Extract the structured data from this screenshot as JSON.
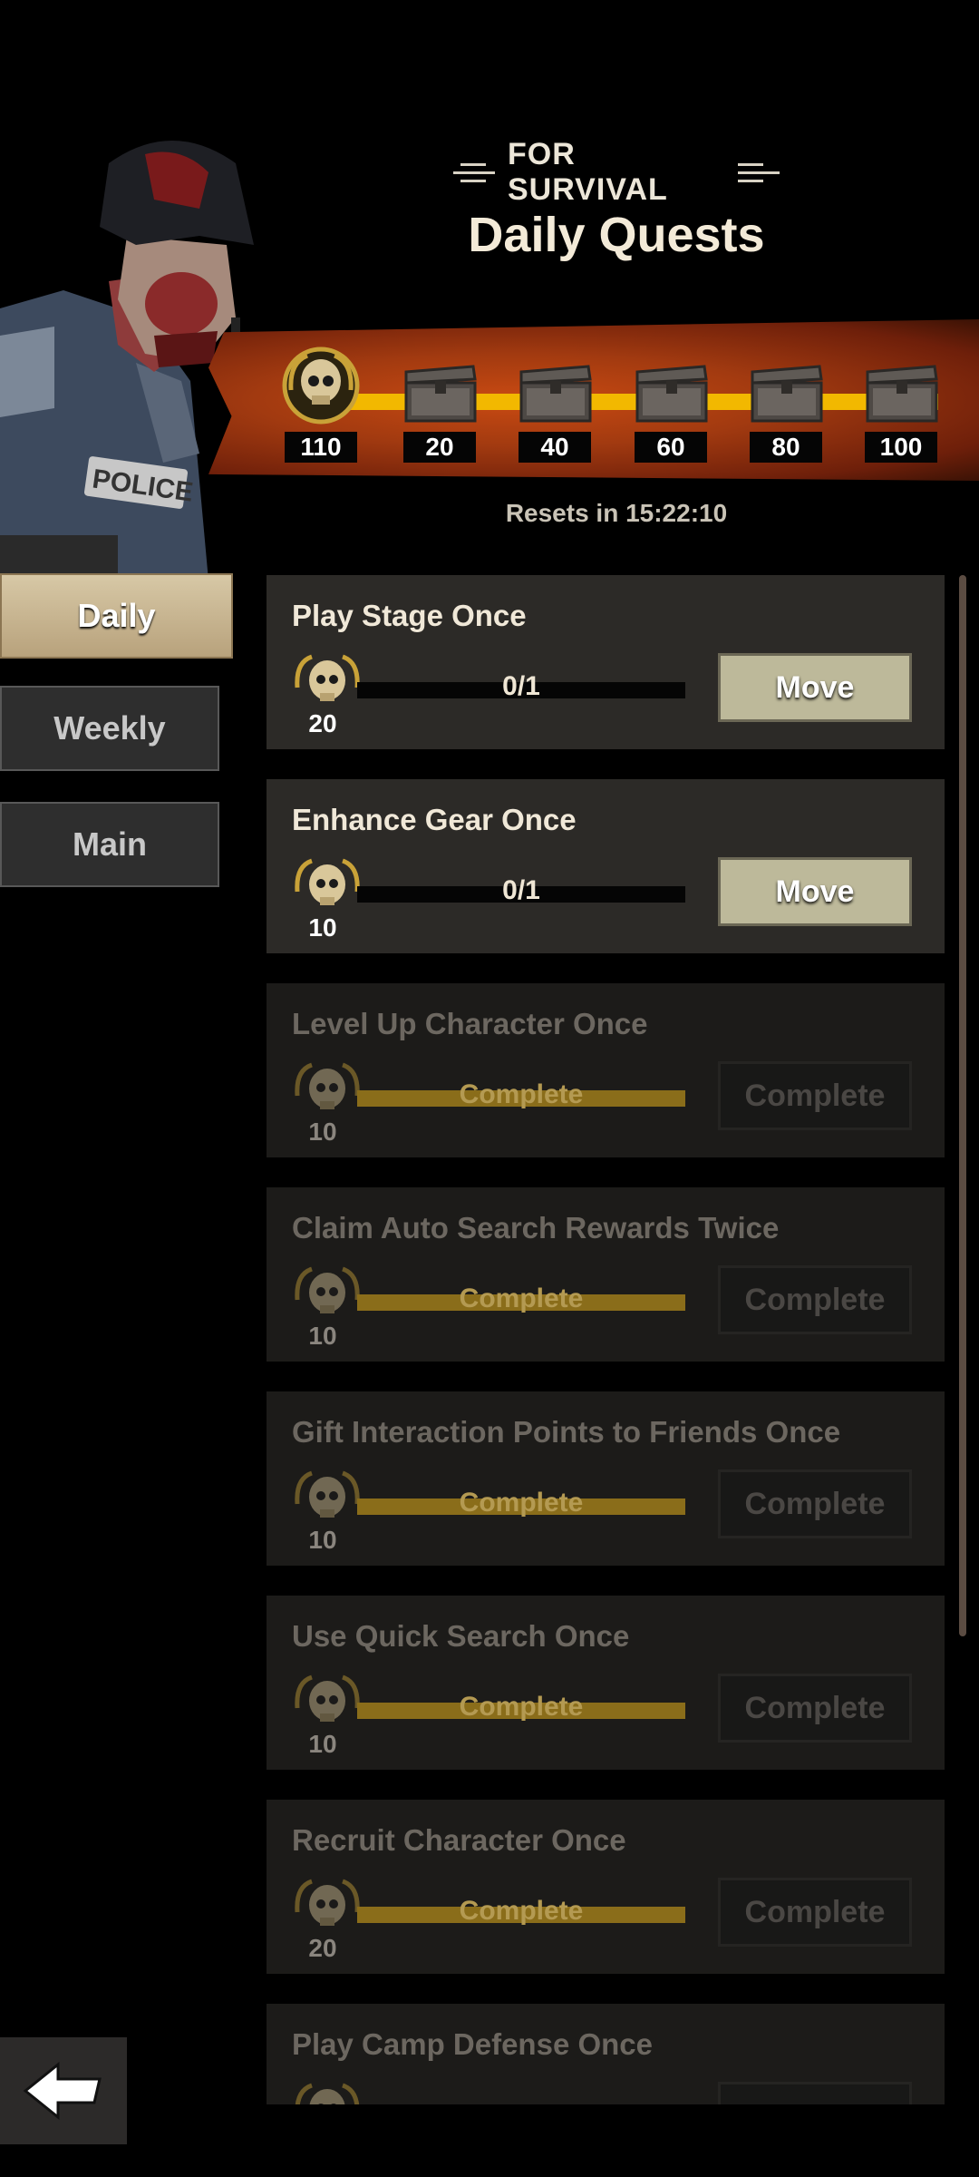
{
  "header": {
    "subtitle": "FOR SURVIVAL",
    "title": "Daily Quests"
  },
  "rewards": {
    "current_points": "110",
    "milestones": [
      "20",
      "40",
      "60",
      "80",
      "100"
    ]
  },
  "reset_text": "Resets in 15:22:10",
  "tabs": {
    "daily": "Daily",
    "weekly": "Weekly",
    "main": "Main"
  },
  "quests": [
    {
      "name": "Play Stage Once",
      "points": "20",
      "progress": "0/1",
      "button": "Move",
      "progress_fraction": 0
    },
    {
      "name": "Enhance Gear Once",
      "points": "10",
      "progress": "0/1",
      "button": "Move",
      "progress_fraction": 0
    },
    {
      "name": "Level Up Character Once",
      "points": "10",
      "progress": "Complete",
      "button": "Complete",
      "progress_fraction": 1
    },
    {
      "name": "Claim Auto Search Rewards Twice",
      "points": "10",
      "progress": "Complete",
      "button": "Complete",
      "progress_fraction": 1
    },
    {
      "name": "Gift Interaction Points to Friends Once",
      "points": "10",
      "progress": "Complete",
      "button": "Complete",
      "progress_fraction": 1
    },
    {
      "name": "Use Quick Search Once",
      "points": "10",
      "progress": "Complete",
      "button": "Complete",
      "progress_fraction": 1
    },
    {
      "name": "Recruit Character Once",
      "points": "20",
      "progress": "Complete",
      "button": "Complete",
      "progress_fraction": 1
    },
    {
      "name": "Play Camp Defense Once"
    }
  ],
  "colors": {
    "banner": "#a23a10",
    "track": "#f2b800",
    "move_button": "#bdb99a"
  },
  "icons": {
    "skull": "skull-badge-icon",
    "chest": "treasure-chest-icon",
    "back": "back-arrow-icon"
  }
}
